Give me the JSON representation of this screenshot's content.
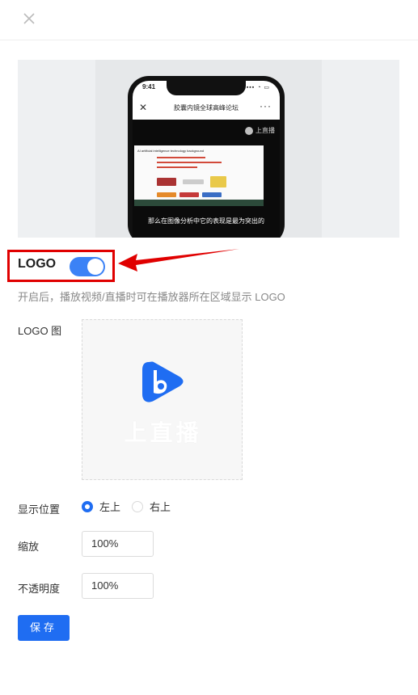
{
  "dialog": {
    "close_icon": "close-icon"
  },
  "preview": {
    "status_time": "9:41",
    "status_icons": "▪▪▪ ◔ ▭",
    "nav_close": "✕",
    "nav_title": "胶囊内镜全球高峰论坛",
    "nav_more": "···",
    "video_logo_text": "上直播",
    "slide_title": "AI artificial intelligence technology background",
    "subtitle": "那么在图像分析中它的表现是最为突出的"
  },
  "logo_section": {
    "label": "LOGO",
    "toggle_on": true,
    "hint": "开启后，播放视频/直播时可在播放器所在区域显示 LOGO"
  },
  "logo_image": {
    "label": "LOGO 图",
    "brand_text": "上直播",
    "brand_color": "#1f6df2"
  },
  "position": {
    "label": "显示位置",
    "options": [
      {
        "label": "左上",
        "checked": true
      },
      {
        "label": "右上",
        "checked": false
      }
    ]
  },
  "scale": {
    "label": "缩放",
    "value": "100%"
  },
  "opacity": {
    "label": "不透明度",
    "value": "100%"
  },
  "save_button": {
    "label": "保存"
  },
  "colors": {
    "accent": "#1f6df2",
    "toggle": "#3b82f6",
    "annotation": "#e00000"
  }
}
